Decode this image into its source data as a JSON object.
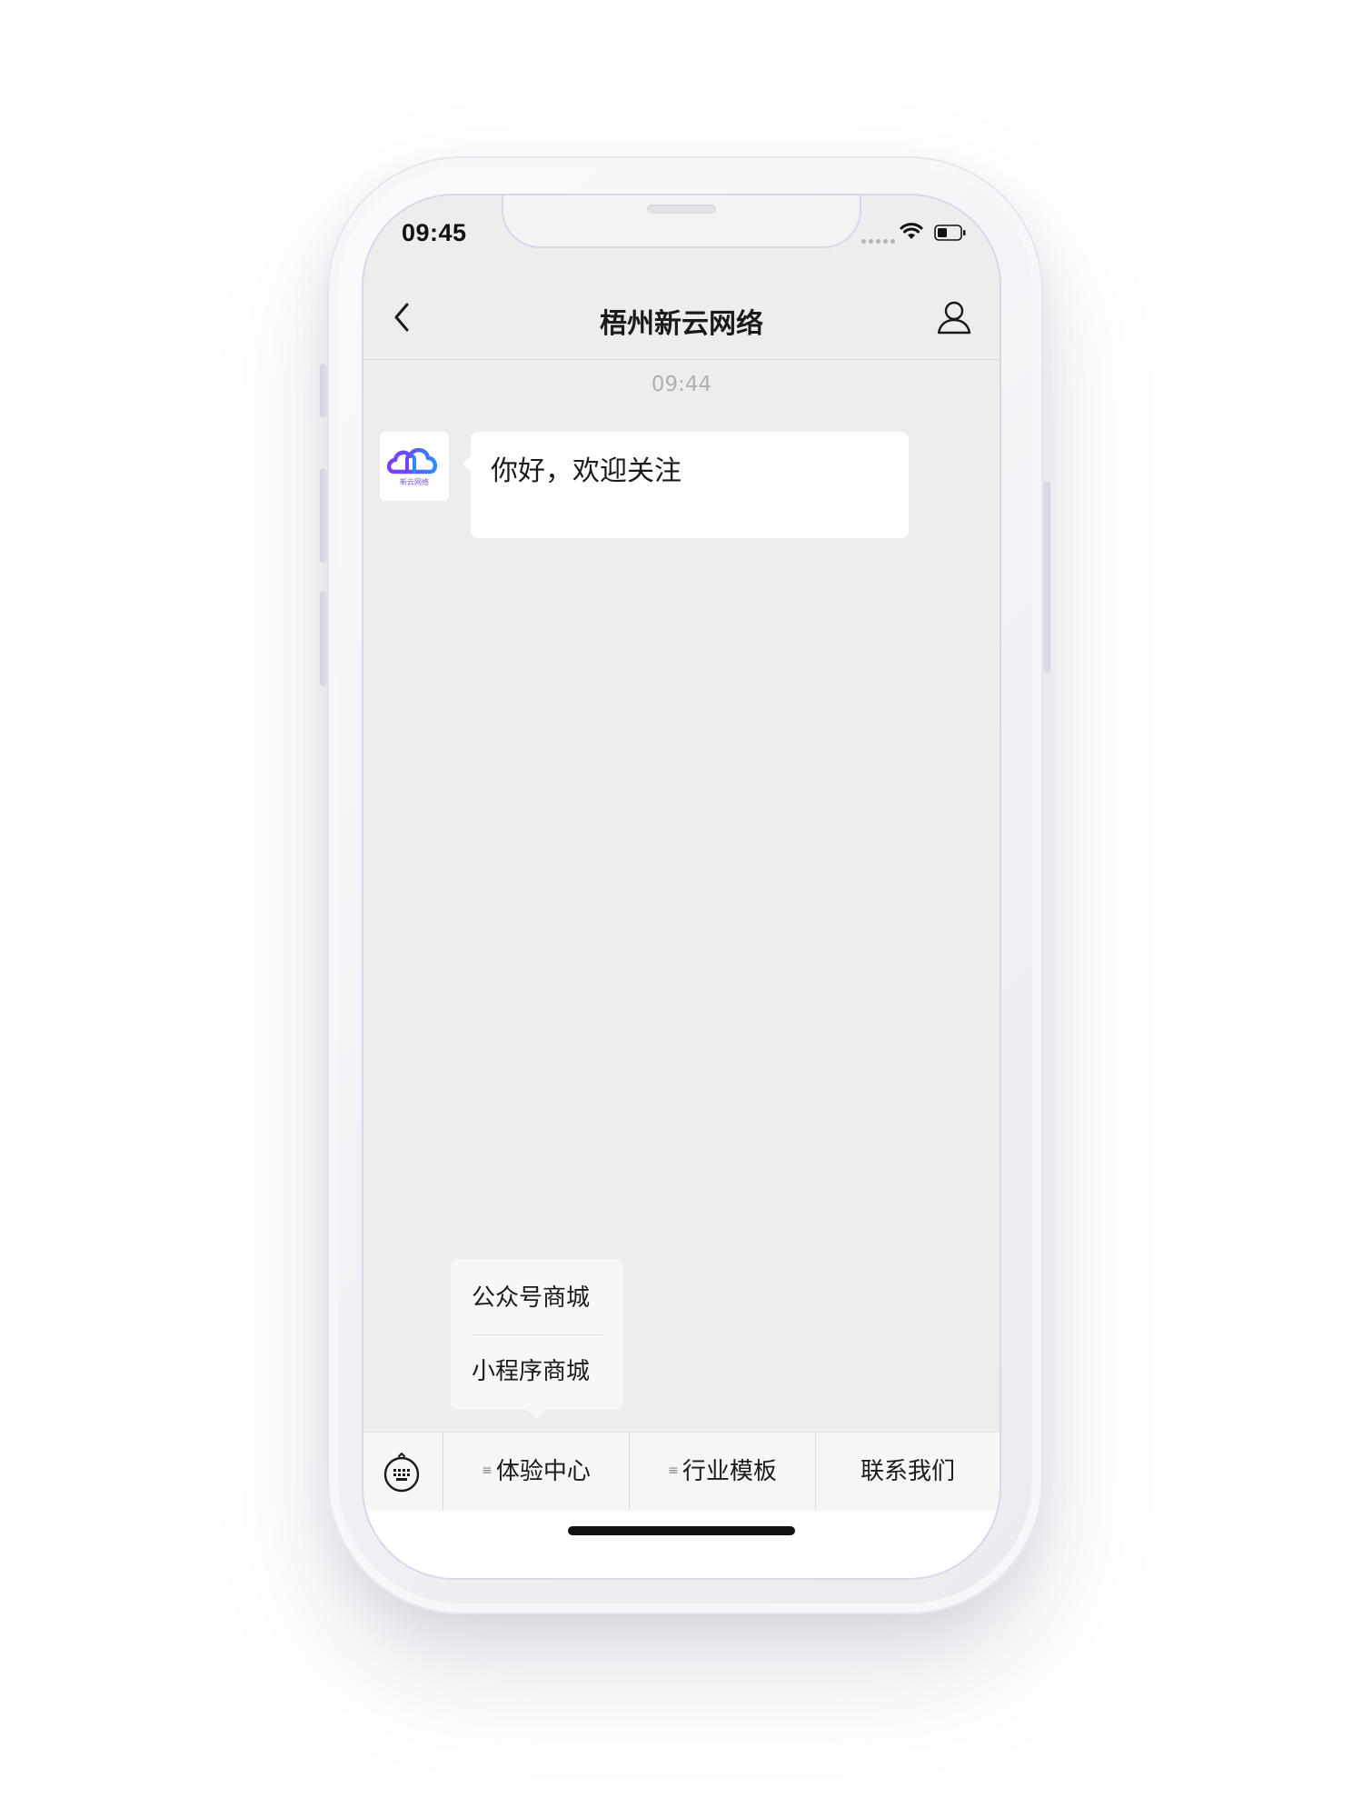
{
  "status_bar": {
    "time": "09:45"
  },
  "nav": {
    "title": "梧州新云网络"
  },
  "chat": {
    "timestamp": "09:44",
    "messages": [
      {
        "sender": "account",
        "avatar_caption": "新云网络",
        "text": "你好，欢迎关注"
      }
    ]
  },
  "submenu": {
    "items": [
      {
        "label": "公众号商城"
      },
      {
        "label": "小程序商城"
      }
    ]
  },
  "menu": {
    "tabs": [
      {
        "label": "体验中心",
        "has_submenu": true,
        "glyph": "≡"
      },
      {
        "label": "行业模板",
        "has_submenu": true,
        "glyph": "≡"
      },
      {
        "label": "联系我们",
        "has_submenu": false
      }
    ]
  },
  "colors": {
    "chat_background": "#ededed",
    "bubble": "#ffffff",
    "menu_bar": "#f6f6f6",
    "logo_gradient_start": "#7b3ff2",
    "logo_gradient_end": "#2f8cff"
  }
}
